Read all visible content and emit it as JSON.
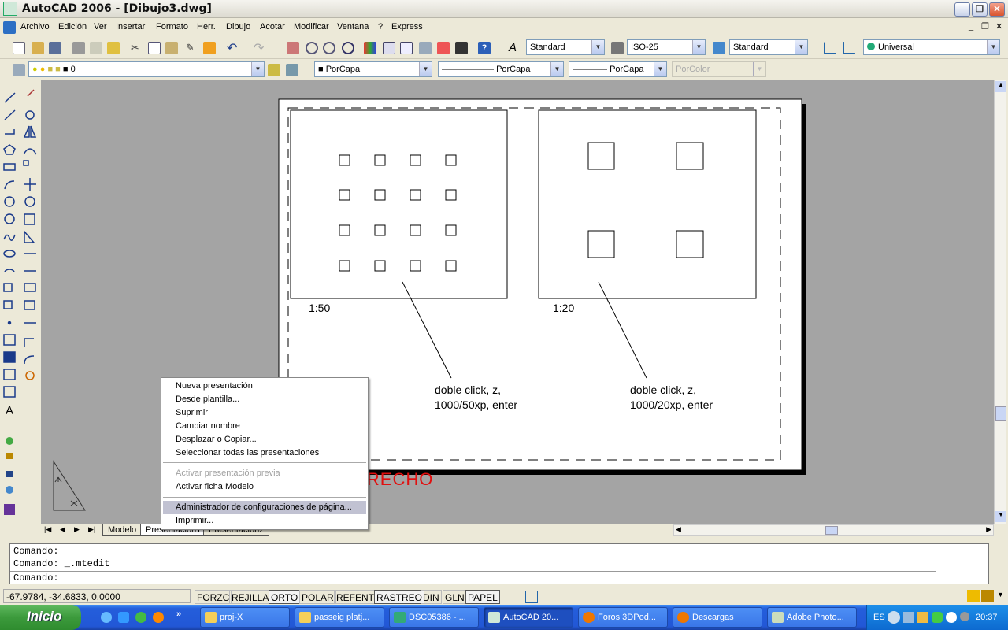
{
  "window": {
    "title": "AutoCAD 2006 - [Dibujo3.dwg]"
  },
  "menu": [
    "Archivo",
    "Edición",
    "Ver",
    "Insertar",
    "Formato",
    "Herr.",
    "Dibujo",
    "Acotar",
    "Modificar",
    "Ventana",
    "?",
    "Express"
  ],
  "toolbar": {
    "text_style": "Standard",
    "dim_style": "ISO-25",
    "table_style": "Standard",
    "ucs": "Universal",
    "layer": "0",
    "color": "PorCapa",
    "linetype": "PorCapa",
    "lineweight": "PorCapa",
    "plotstyle": "PorColor"
  },
  "drawing": {
    "viewport1_scale": "1:50",
    "viewport2_scale": "1:20",
    "note1_line1": "doble click, z,",
    "note1_line2": "1000/50xp, enter",
    "note2_line1": "doble click, z,",
    "note2_line2": "1000/20xp, enter",
    "annotation": "BOTÓN DERECHO"
  },
  "tabs": [
    "Modelo",
    "Presentación1",
    "Presentación2"
  ],
  "context_menu": {
    "items": [
      {
        "label": "Nueva presentación",
        "enabled": true
      },
      {
        "label": "Desde plantilla...",
        "enabled": true
      },
      {
        "label": "Suprimir",
        "enabled": true
      },
      {
        "label": "Cambiar nombre",
        "enabled": true
      },
      {
        "label": "Desplazar o Copiar...",
        "enabled": true
      },
      {
        "label": "Seleccionar todas las presentaciones",
        "enabled": true
      },
      {
        "label": "Activar presentación previa",
        "enabled": false
      },
      {
        "label": "Activar ficha Modelo",
        "enabled": true
      },
      {
        "label": "Administrador de configuraciones de página...",
        "enabled": true,
        "highlighted": true
      },
      {
        "label": "Imprimir...",
        "enabled": true
      }
    ]
  },
  "command": {
    "lines": [
      "Comando:",
      "Comando: _.mtedit"
    ],
    "prompt": "Comando:"
  },
  "status": {
    "coords": "-67.9784, -34.6833, 0.0000",
    "toggles": [
      {
        "label": "FORZC",
        "on": false
      },
      {
        "label": "REJILLA",
        "on": false
      },
      {
        "label": "ORTO",
        "on": true
      },
      {
        "label": "POLAR",
        "on": false
      },
      {
        "label": "REFENT",
        "on": false
      },
      {
        "label": "RASTREO",
        "on": true
      },
      {
        "label": "DIN",
        "on": false
      },
      {
        "label": "GLN",
        "on": false
      },
      {
        "label": "PAPEL",
        "on": true
      }
    ]
  },
  "taskbar": {
    "start": "Inicio",
    "tasks": [
      "proj-X",
      "passeig platj...",
      "DSC05386 - ...",
      "AutoCAD 20...",
      "Foros 3DPod...",
      "Descargas",
      "Adobe Photo..."
    ],
    "language": "ES",
    "clock": "20:37"
  },
  "colors": {
    "annotation": "#e01010",
    "canvas": "#a4a4a4",
    "menu_highlight": "#c1c2d2"
  }
}
